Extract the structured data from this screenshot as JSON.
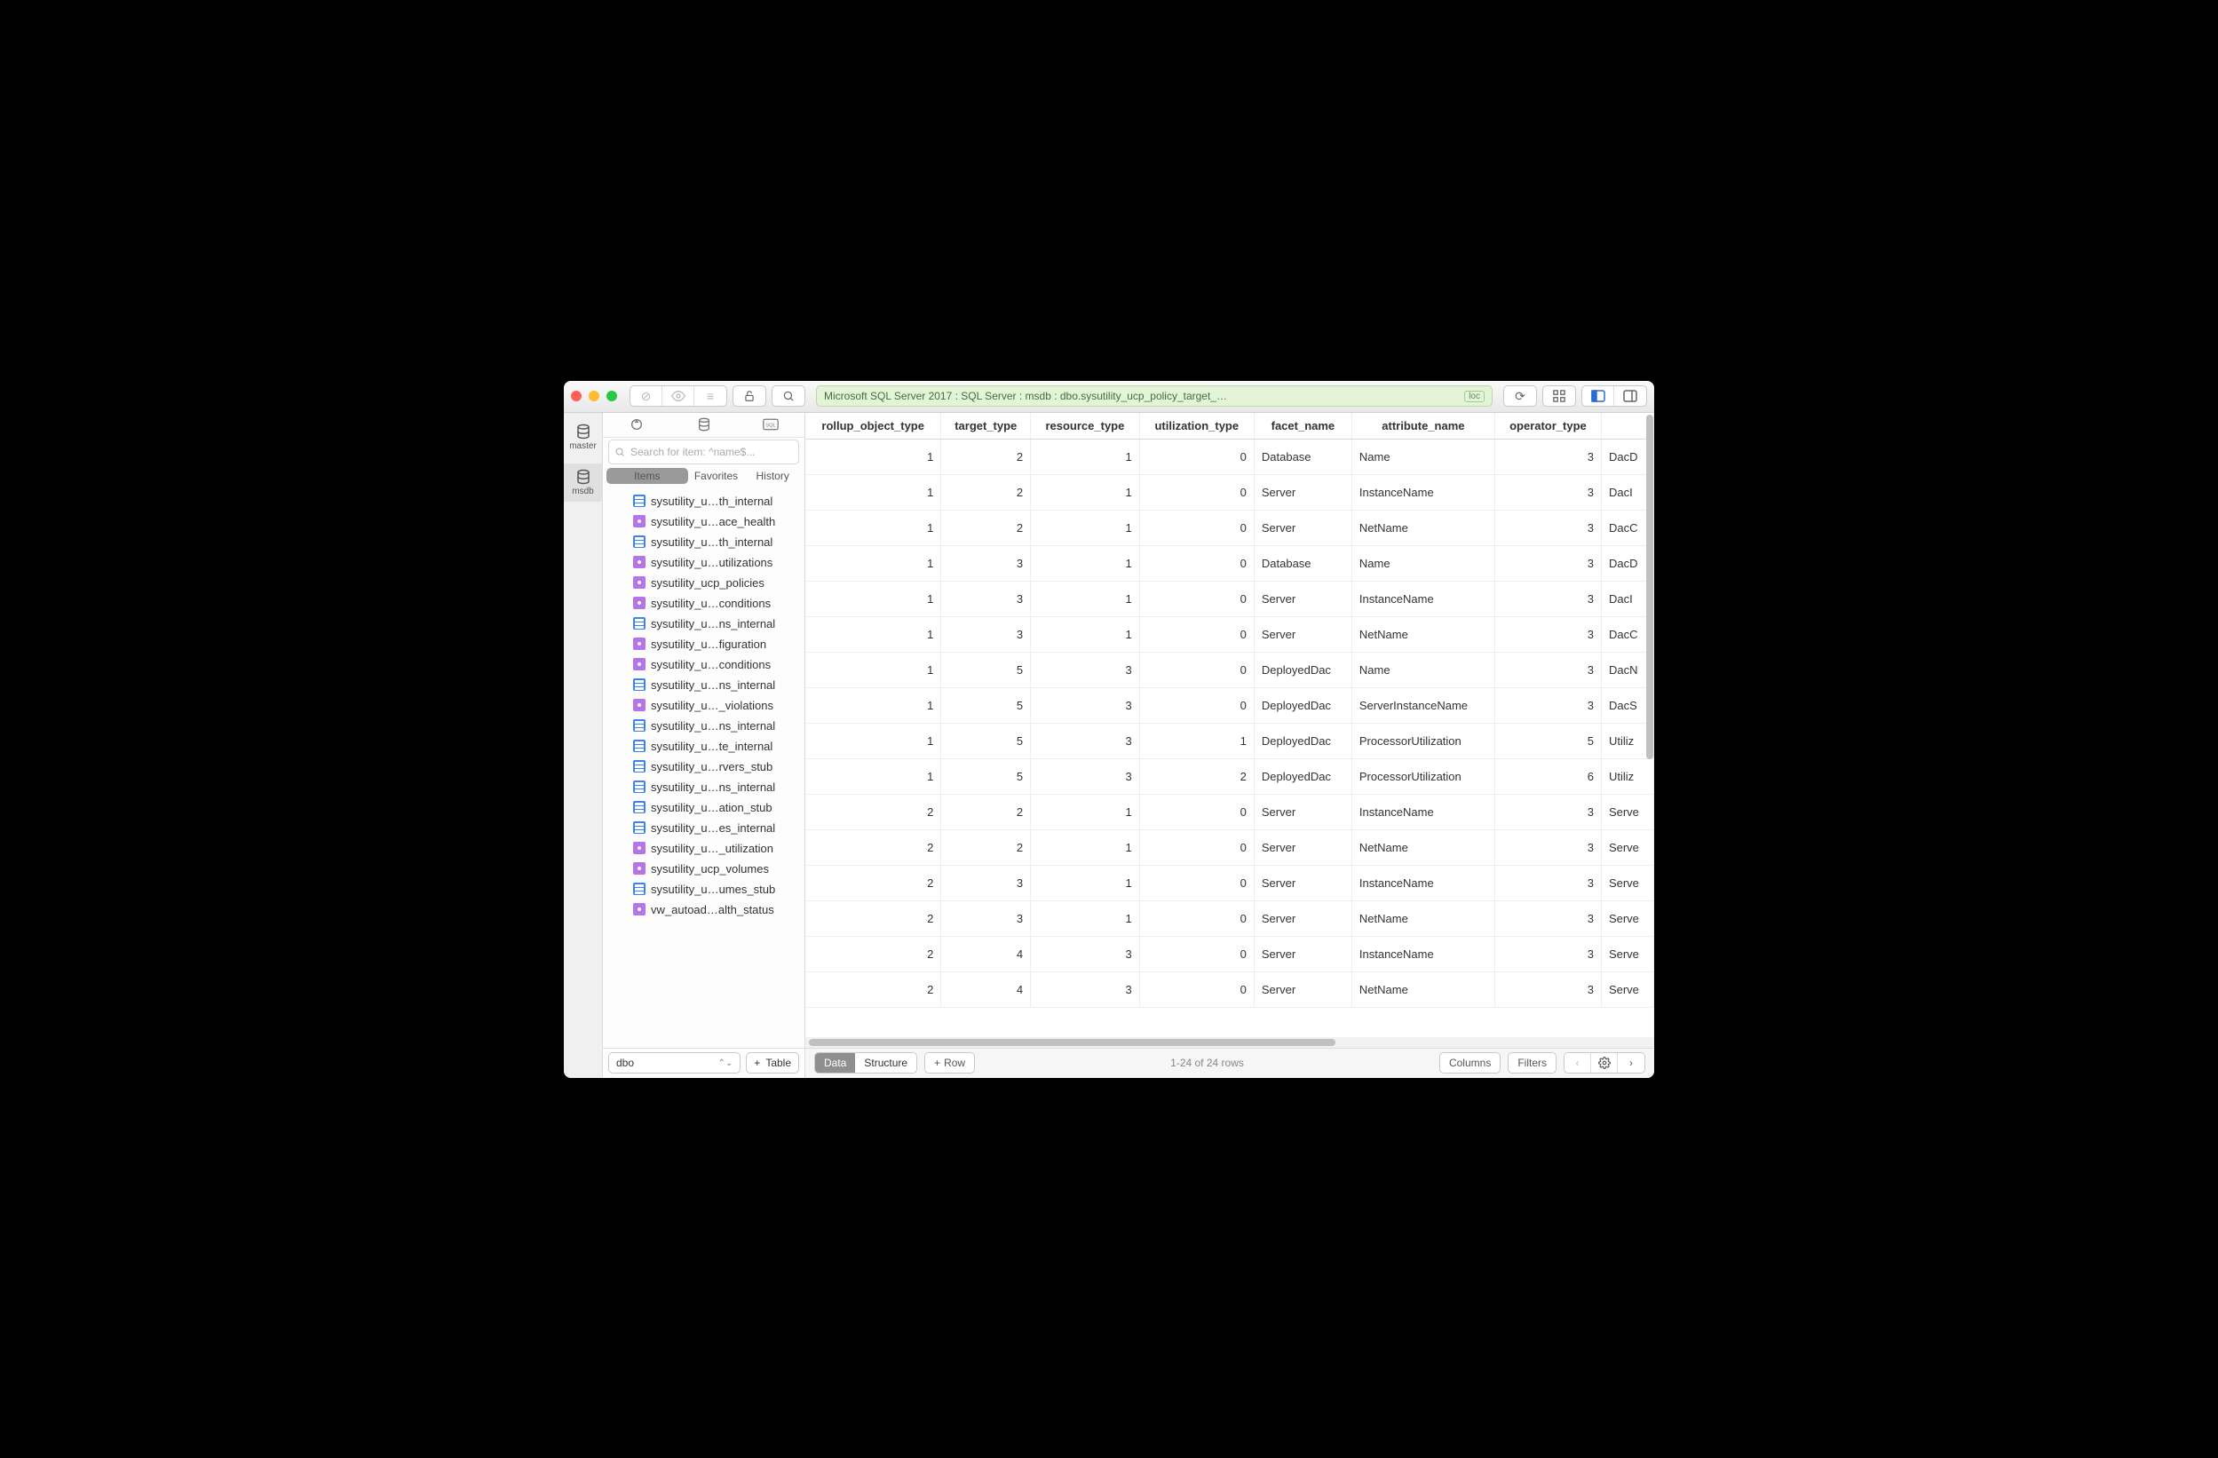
{
  "titlebar": {
    "breadcrumb": "Microsoft SQL Server 2017 : SQL Server : msdb : dbo.sysutility_ucp_policy_target_…",
    "loc_badge": "loc"
  },
  "dbs": [
    {
      "name": "master",
      "active": false
    },
    {
      "name": "msdb",
      "active": true
    }
  ],
  "search_placeholder": "Search for item: ^name$...",
  "seg": {
    "items": "Items",
    "favorites": "Favorites",
    "history": "History"
  },
  "tree": [
    {
      "type": "table",
      "label": "sysutility_u…th_internal"
    },
    {
      "type": "view",
      "label": "sysutility_u…ace_health"
    },
    {
      "type": "table",
      "label": "sysutility_u…th_internal"
    },
    {
      "type": "view",
      "label": "sysutility_u…utilizations"
    },
    {
      "type": "view",
      "label": "sysutility_ucp_policies"
    },
    {
      "type": "view",
      "label": "sysutility_u…conditions"
    },
    {
      "type": "table",
      "label": "sysutility_u…ns_internal"
    },
    {
      "type": "view",
      "label": "sysutility_u…figuration"
    },
    {
      "type": "view",
      "label": "sysutility_u…conditions"
    },
    {
      "type": "table",
      "label": "sysutility_u…ns_internal"
    },
    {
      "type": "view",
      "label": "sysutility_u…_violations"
    },
    {
      "type": "table",
      "label": "sysutility_u…ns_internal"
    },
    {
      "type": "table",
      "label": "sysutility_u…te_internal"
    },
    {
      "type": "table",
      "label": "sysutility_u…rvers_stub"
    },
    {
      "type": "table",
      "label": "sysutility_u…ns_internal"
    },
    {
      "type": "table",
      "label": "sysutility_u…ation_stub"
    },
    {
      "type": "table",
      "label": "sysutility_u…es_internal"
    },
    {
      "type": "view",
      "label": "sysutility_u…_utilization"
    },
    {
      "type": "view",
      "label": "sysutility_ucp_volumes"
    },
    {
      "type": "table",
      "label": "sysutility_u…umes_stub"
    },
    {
      "type": "view",
      "label": "vw_autoad…alth_status"
    }
  ],
  "schema": "dbo",
  "add_table": "Table",
  "columns": [
    "rollup_object_type",
    "target_type",
    "resource_type",
    "utilization_type",
    "facet_name",
    "attribute_name",
    "operator_type",
    ""
  ],
  "rows": [
    [
      1,
      2,
      1,
      0,
      "Database",
      "Name",
      3,
      "DacD"
    ],
    [
      1,
      2,
      1,
      0,
      "Server",
      "InstanceName",
      3,
      "DacI"
    ],
    [
      1,
      2,
      1,
      0,
      "Server",
      "NetName",
      3,
      "DacC"
    ],
    [
      1,
      3,
      1,
      0,
      "Database",
      "Name",
      3,
      "DacD"
    ],
    [
      1,
      3,
      1,
      0,
      "Server",
      "InstanceName",
      3,
      "DacI"
    ],
    [
      1,
      3,
      1,
      0,
      "Server",
      "NetName",
      3,
      "DacC"
    ],
    [
      1,
      5,
      3,
      0,
      "DeployedDac",
      "Name",
      3,
      "DacN"
    ],
    [
      1,
      5,
      3,
      0,
      "DeployedDac",
      "ServerInstanceName",
      3,
      "DacS"
    ],
    [
      1,
      5,
      3,
      1,
      "DeployedDac",
      "ProcessorUtilization",
      5,
      "Utiliz"
    ],
    [
      1,
      5,
      3,
      2,
      "DeployedDac",
      "ProcessorUtilization",
      6,
      "Utiliz"
    ],
    [
      2,
      2,
      1,
      0,
      "Server",
      "InstanceName",
      3,
      "Serve"
    ],
    [
      2,
      2,
      1,
      0,
      "Server",
      "NetName",
      3,
      "Serve"
    ],
    [
      2,
      3,
      1,
      0,
      "Server",
      "InstanceName",
      3,
      "Serve"
    ],
    [
      2,
      3,
      1,
      0,
      "Server",
      "NetName",
      3,
      "Serve"
    ],
    [
      2,
      4,
      3,
      0,
      "Server",
      "InstanceName",
      3,
      "Serve"
    ],
    [
      2,
      4,
      3,
      0,
      "Server",
      "NetName",
      3,
      "Serve"
    ]
  ],
  "status": {
    "data": "Data",
    "structure": "Structure",
    "row": "Row",
    "range": "1-24 of 24 rows",
    "columns": "Columns",
    "filters": "Filters"
  }
}
